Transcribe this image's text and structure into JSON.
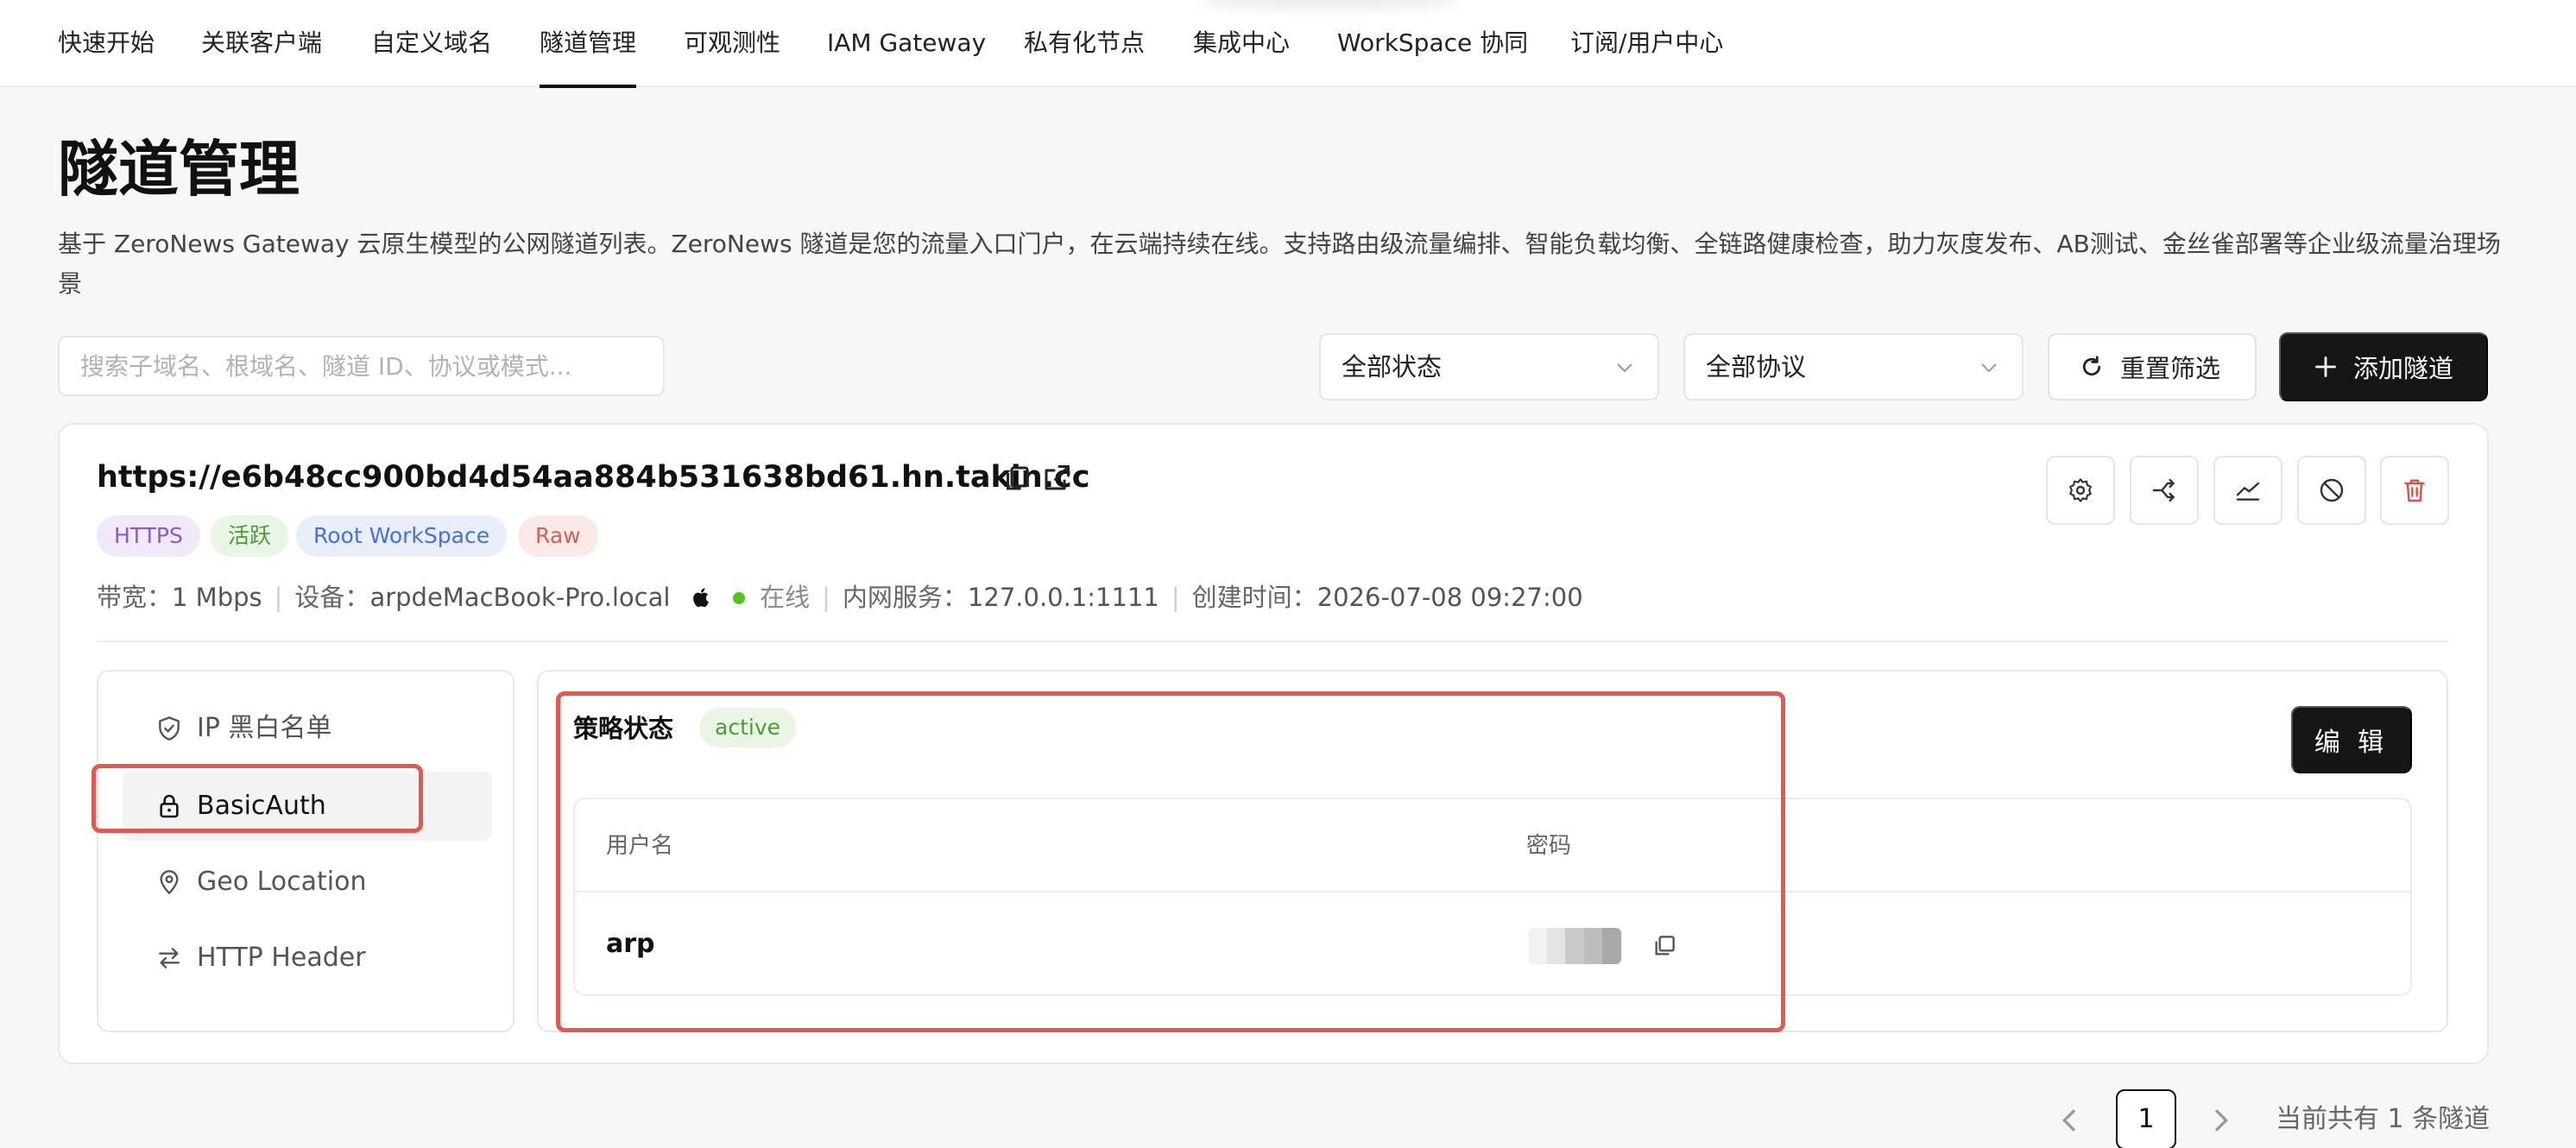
{
  "nav": {
    "items": [
      {
        "label": "快速开始",
        "active": false
      },
      {
        "label": "关联客户端",
        "active": false
      },
      {
        "label": "自定义域名",
        "active": false
      },
      {
        "label": "隧道管理",
        "active": true
      },
      {
        "label": "可观测性",
        "active": false
      },
      {
        "label": "IAM Gateway",
        "active": false
      },
      {
        "label": "私有化节点",
        "active": false
      },
      {
        "label": "集成中心",
        "active": false
      },
      {
        "label": "WorkSpace 协同",
        "active": false
      },
      {
        "label": "订阅/用户中心",
        "active": false
      }
    ]
  },
  "header": {
    "title": "隧道管理",
    "description": "基于 ZeroNews Gateway 云原生模型的公网隧道列表。ZeroNews 隧道是您的流量入口门户，在云端持续在线。支持路由级流量编排、智能负载均衡、全链路健康检查，助力灰度发布、AB测试、金丝雀部署等企业级流量治理场景"
  },
  "filters": {
    "search_placeholder": "搜索子域名、根域名、隧道 ID、协议或模式...",
    "status_select": "全部状态",
    "protocol_select": "全部协议",
    "reset_label": "重置筛选",
    "add_label": "添加隧道"
  },
  "tunnel": {
    "url": "https://e6b48cc900bd4d54aa884b531638bd61.hn.takin.cc",
    "tags": [
      {
        "label": "HTTPS",
        "bg": "#f1e9fb",
        "fg": "#8a5bc7"
      },
      {
        "label": "活跃",
        "bg": "#e9f6e6",
        "fg": "#4d9a3d"
      },
      {
        "label": "Root WorkSpace",
        "bg": "#e8eefc",
        "fg": "#4a6fd6"
      },
      {
        "label": "Raw",
        "bg": "#fbe9e8",
        "fg": "#d0605a"
      }
    ],
    "meta": {
      "bandwidth_label": "带宽：",
      "bandwidth": "1 Mbps",
      "device_label": "设备：",
      "device": "arpdeMacBook-Pro.local",
      "online": "在线",
      "service_label": "内网服务：",
      "service": "127.0.0.1:1111",
      "created_label": "创建时间：",
      "created": "2026-07-08 09:27:00"
    },
    "actions": [
      "gear-icon",
      "share-icon",
      "chart-icon",
      "ban-icon",
      "trash-icon"
    ]
  },
  "policies": {
    "items": [
      {
        "label": "IP 黑白名单",
        "icon": "shield-icon",
        "active": false
      },
      {
        "label": "BasicAuth",
        "icon": "lock-icon",
        "active": true
      },
      {
        "label": "Geo Location",
        "icon": "location-pin-icon",
        "active": false
      },
      {
        "label": "HTTP Header",
        "icon": "swap-arrows-icon",
        "active": false
      }
    ],
    "panel": {
      "title": "策略状态",
      "status": "active",
      "edit_label": "编 辑",
      "columns": [
        "用户名",
        "密码"
      ],
      "rows": [
        {
          "username": "arp"
        }
      ]
    }
  },
  "pagination": {
    "current": "1",
    "total_text": "当前共有 1 条隧道"
  },
  "colors": {
    "accent_dark": "#161616",
    "highlight_red": "#e05a4f",
    "online_green": "#52c41a"
  }
}
